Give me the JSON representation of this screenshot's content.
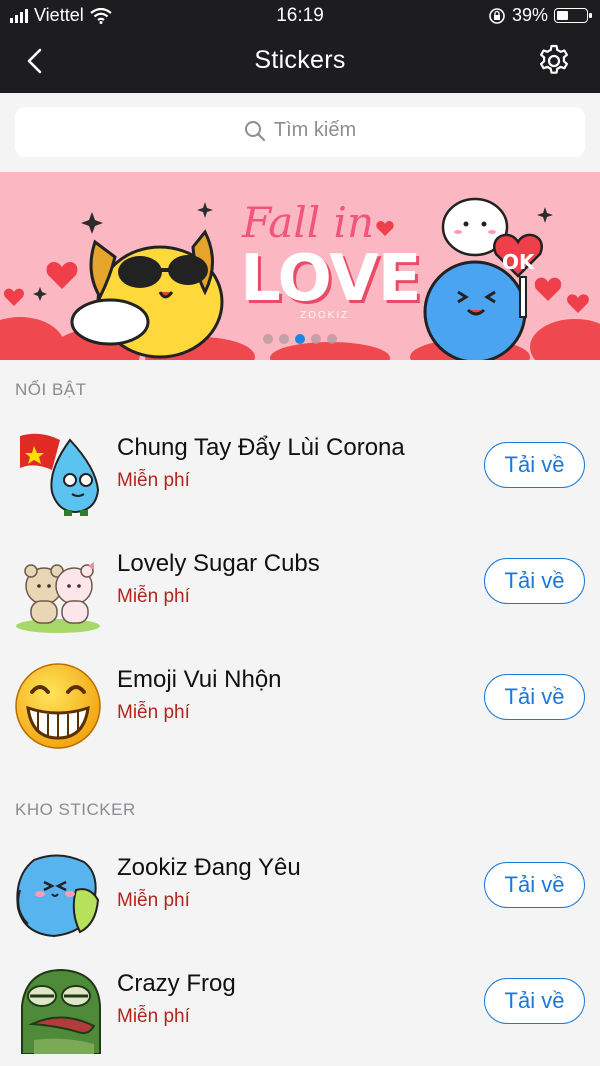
{
  "status_bar": {
    "carrier": "Viettel",
    "time": "16:19",
    "battery": "39%",
    "battery_level": 0.39
  },
  "header": {
    "title": "Stickers",
    "back_icon": "chevron-left-icon",
    "settings_icon": "gear-icon"
  },
  "search": {
    "placeholder": "Tìm kiếm",
    "icon": "search-icon"
  },
  "banner": {
    "title_script": "Fall in",
    "title_main": "LOVE",
    "brand": "ZOOKIZ",
    "badge": "OK",
    "dots_count": 5,
    "active_dot": 2
  },
  "featured": {
    "label": "NỔI BẬT",
    "items": [
      {
        "name": "Chung Tay Đẩy Lùi Corona",
        "price": "Miễn phí",
        "button": "Tải về"
      },
      {
        "name": "Lovely Sugar Cubs",
        "price": "Miễn phí",
        "button": "Tải về"
      },
      {
        "name": "Emoji Vui Nhộn",
        "price": "Miễn phí",
        "button": "Tải về"
      }
    ]
  },
  "store": {
    "label": "KHO STICKER",
    "items": [
      {
        "name": "Zookiz Đang Yêu",
        "price": "Miễn phí",
        "button": "Tải về"
      },
      {
        "name": "Crazy Frog",
        "price": "Miễn phí",
        "button": "Tải về"
      }
    ]
  },
  "colors": {
    "accent": "#1a79d8",
    "price": "#b3241f",
    "header": "#1d1d1f",
    "banner": "#fbb8c2"
  }
}
